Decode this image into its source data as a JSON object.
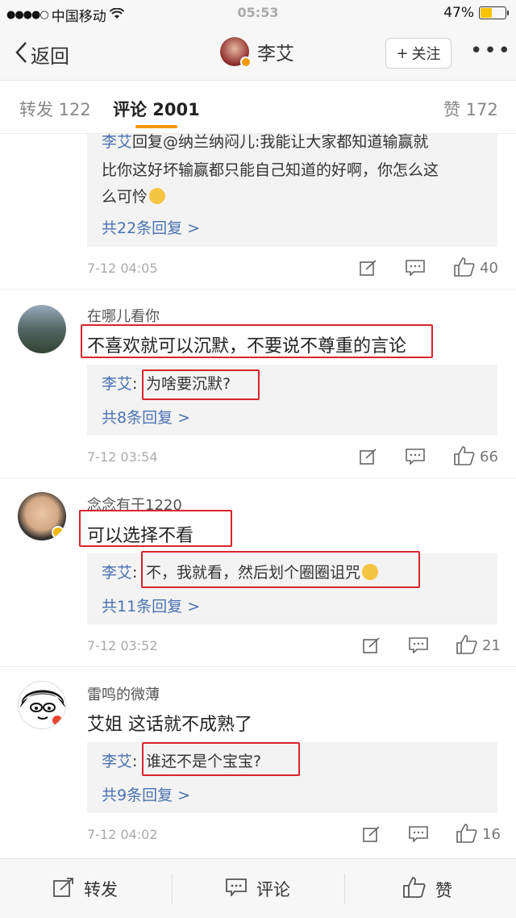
{
  "status": {
    "carrier": "中国移动",
    "time": "05:53",
    "battery": "47%",
    "battery_level": 0.47
  },
  "nav": {
    "back_label": "返回",
    "user_name": "李艾",
    "follow_label": "关注"
  },
  "tabs": {
    "repost": "转发 122",
    "comment": "评论 2001",
    "like": "赞 172"
  },
  "thread0": {
    "reply_name": "李艾",
    "reply_line1": "回复@纳兰纳闷儿:我能让大家都知道输赢就",
    "reply_line2": "比你这好坏输赢都只能自己知道的好啊，你怎么这",
    "reply_line3": "么可怜",
    "more": "共22条回复 >",
    "time": "7-12 04:05",
    "likes": "40"
  },
  "comments": [
    {
      "user": "在哪儿看你",
      "text": "不喜欢就可以沉默，不要说不尊重的言论",
      "reply_name": "李艾",
      "reply_text": "为啥要沉默?",
      "more": "共8条回复 >",
      "time": "7-12 03:54",
      "likes": "66"
    },
    {
      "user": "念念有于1220",
      "text": "可以选择不看",
      "reply_name": "李艾",
      "reply_text": "不，我就看，然后划个圈圈诅咒",
      "more": "共11条回复 >",
      "time": "7-12 03:52",
      "likes": "21"
    },
    {
      "user": "雷鸣的微薄",
      "text": "艾姐 这话就不成熟了",
      "reply_name": "李艾",
      "reply_text": "谁还不是个宝宝?",
      "more": "共9条回复 >",
      "time": "7-12 04:02",
      "likes": "16"
    }
  ],
  "bottom": {
    "repost": "转发",
    "comment": "评论",
    "like": "赞"
  },
  "colors": {
    "accent": "#f39800",
    "link": "#4a72b3",
    "highlight": "#d8242c"
  }
}
